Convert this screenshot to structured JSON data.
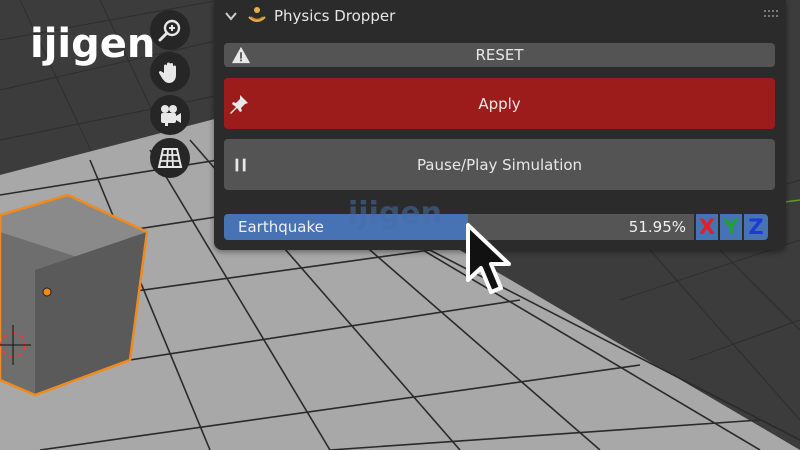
{
  "logo": {
    "text": "ijigen"
  },
  "watermark": {
    "text": "ijigen"
  },
  "viewport_tools": [
    {
      "name": "zoom-icon"
    },
    {
      "name": "hand-icon"
    },
    {
      "name": "camera-icon"
    },
    {
      "name": "grid-icon"
    }
  ],
  "panel": {
    "title": "Physics Dropper",
    "reset_label": "RESET",
    "apply_label": "Apply",
    "pause_label": "Pause/Play Simulation",
    "earthquake": {
      "label": "Earthquake",
      "value_text": "51.95%",
      "value": 0.5195
    },
    "axes": {
      "x": "X",
      "y": "Y",
      "z": "Z"
    }
  },
  "colors": {
    "apply": "#9c1c1c",
    "slider_fill": "#4772b3",
    "axis_x": "#e31e24",
    "axis_y": "#21a038",
    "axis_z": "#1a3bd6",
    "selection_outline": "#f08a1c"
  }
}
